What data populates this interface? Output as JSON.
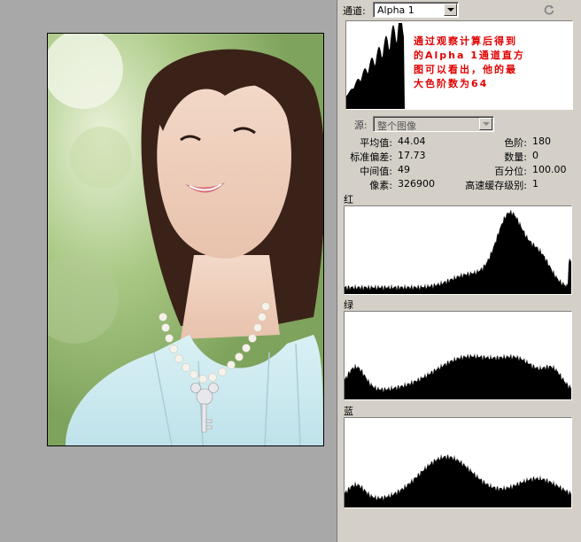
{
  "panel": {
    "channel_label": "通道:",
    "channel_value": "Alpha 1",
    "refresh_icon": "refresh-icon",
    "source_label": "源:",
    "source_value": "整个图像",
    "annotation_lines": [
      "通过观察计算后得到",
      "的Alpha 1通道直方",
      "图可以看出，他的最",
      "大色阶数为64"
    ],
    "stats": {
      "mean_label": "平均值:",
      "mean_value": "44.04",
      "std_label": "标准偏差:",
      "std_value": "17.73",
      "median_label": "中间值:",
      "median_value": "49",
      "pixels_label": "像素:",
      "pixels_value": "326900",
      "level_label": "色阶:",
      "level_value": "180",
      "count_label": "数量:",
      "count_value": "0",
      "percentile_label": "百分位:",
      "percentile_value": "100.00",
      "cache_label": "高速缓存级别:",
      "cache_value": "1"
    },
    "channels": {
      "red_label": "红",
      "green_label": "绿",
      "blue_label": "蓝"
    },
    "colors": {
      "annotation": "#e00000",
      "histogram": "#000000"
    }
  }
}
